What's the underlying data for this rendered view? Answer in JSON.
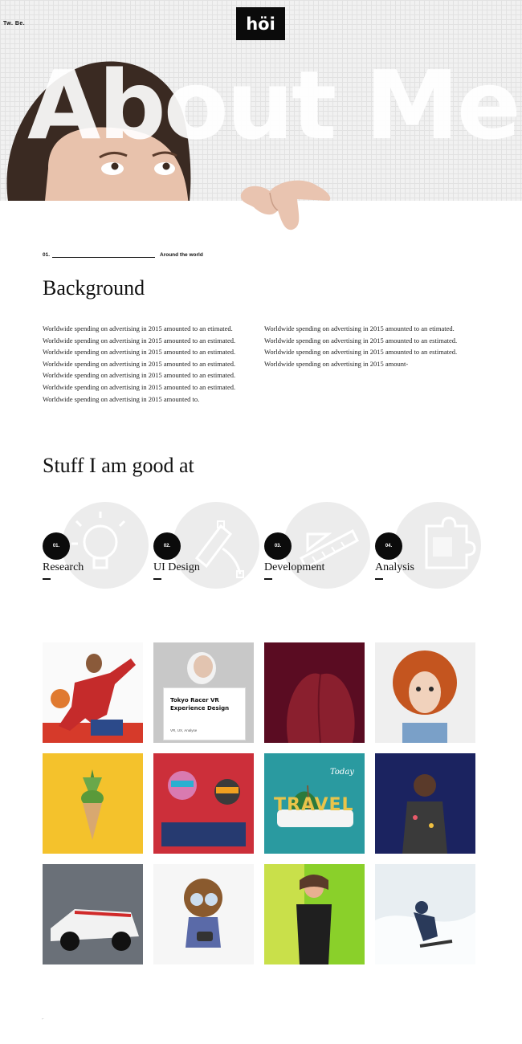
{
  "header": {
    "corner_label": "Tw. Be.",
    "logo": "höi",
    "title": "About Me"
  },
  "background_section": {
    "number": "01.",
    "kicker": "Around the world",
    "heading": "Background",
    "paragraph_left": "Worldwide spending on advertising in 2015 amounted to an etimated. Worldwide spending on advertising in 2015 amounted to an estimated. Worldwide spending on advertising in 2015 amounted to an estimated. Worldwide spending on advertising in 2015 amounted to an estimated. Worldwide spending on advertising in 2015 amounted to an estimated. Worldwide spending on advertising in 2015 amounted to an estimated. Worldwide spending on advertising in 2015 amounted to.",
    "paragraph_right": "Worldwide spending on advertising in 2015 amounted to an etimated. Worldwide spending on advertising in 2015 amounted to an estimated. Worldwide spending on advertising in 2015 amounted to an estimated. Worldwide spending on advertising in 2015 amount-"
  },
  "skills_section": {
    "heading": "Stuff I am good at",
    "items": [
      {
        "number": "01.",
        "label": "Research",
        "icon": "lightbulb-icon"
      },
      {
        "number": "02.",
        "label": "UI Design",
        "icon": "vector-pen-icon"
      },
      {
        "number": "03.",
        "label": "Development",
        "icon": "ruler-icon"
      },
      {
        "number": "04.",
        "label": "Analysis",
        "icon": "puzzle-icon"
      }
    ]
  },
  "portfolio": {
    "card_title": "Tokyo Racer VR Experience Design",
    "card_subtitle": "VR, UX, Analyse",
    "travel_text": "TRAVEL",
    "travel_script": "Today",
    "tiles": [
      "basketball-player-photo",
      "vr-design-card",
      "red-fruit-photo",
      "curly-hair-girl-photo",
      "pineapple-cone-photo",
      "kids-glasses-photo",
      "travel-phone-photo",
      "speaker-stage-photo",
      "race-car-photo",
      "cartoon-pilot-photo",
      "neon-woman-photo",
      "snowboarder-photo"
    ]
  }
}
